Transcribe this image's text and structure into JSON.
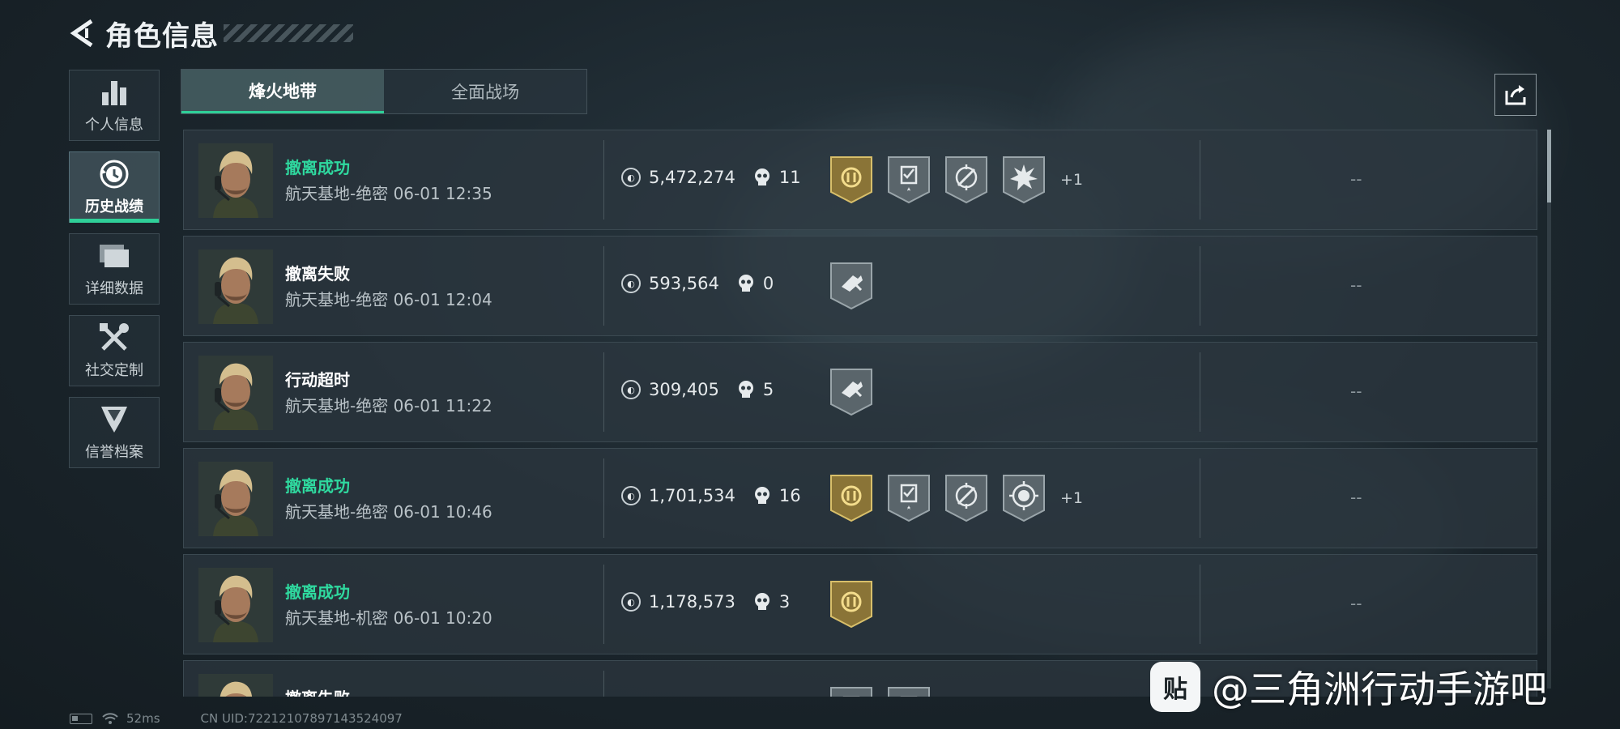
{
  "header": {
    "title": "角色信息"
  },
  "sidebar": {
    "items": [
      {
        "label": "个人信息",
        "icon": "bar-chart-icon"
      },
      {
        "label": "历史战绩",
        "icon": "history-clock-icon"
      },
      {
        "label": "详细数据",
        "icon": "folder-icon"
      },
      {
        "label": "社交定制",
        "icon": "tools-icon"
      },
      {
        "label": "信誉档案",
        "icon": "shield-emblem-icon"
      }
    ],
    "active_index": 1
  },
  "tabs": [
    {
      "label": "烽火地带"
    },
    {
      "label": "全面战场"
    }
  ],
  "records": [
    {
      "status": "撤离成功",
      "status_type": "success",
      "map": "航天基地-绝密",
      "time": "06-01 12:35",
      "value": "5,472,274",
      "kills": "11",
      "badges": [
        "gold-emblem-icon",
        "checklist-star-icon",
        "no-target-icon",
        "explosion-icon"
      ],
      "extra": "+1",
      "result": "--"
    },
    {
      "status": "撤离失败",
      "status_type": "fail",
      "map": "航天基地-绝密",
      "time": "06-01 12:04",
      "value": "593,564",
      "kills": "0",
      "badges": [
        "broken-gun-icon"
      ],
      "extra": "",
      "result": "--"
    },
    {
      "status": "行动超时",
      "status_type": "timeout",
      "map": "航天基地-绝密",
      "time": "06-01 11:22",
      "value": "309,405",
      "kills": "5",
      "badges": [
        "broken-gun-icon"
      ],
      "extra": "",
      "result": "--"
    },
    {
      "status": "撤离成功",
      "status_type": "success",
      "map": "航天基地-绝密",
      "time": "06-01 10:46",
      "value": "1,701,534",
      "kills": "16",
      "badges": [
        "gold-emblem-icon",
        "checklist-star-icon",
        "no-target-icon",
        "skull-target-icon"
      ],
      "extra": "+1",
      "result": "--"
    },
    {
      "status": "撤离成功",
      "status_type": "success",
      "map": "航天基地-机密",
      "time": "06-01 10:20",
      "value": "1,178,573",
      "kills": "3",
      "badges": [
        "gold-emblem-icon"
      ],
      "extra": "",
      "result": "--"
    },
    {
      "status": "撤离失败",
      "status_type": "fail",
      "map": "",
      "time": "",
      "value": "",
      "kills": "",
      "badges": [
        "checklist-star-icon",
        "checklist-star-icon"
      ],
      "extra": "",
      "result": ""
    }
  ],
  "footer": {
    "ping": "52ms",
    "uid": "CN UID:72212107897143524097"
  },
  "watermark": {
    "logo": "贴",
    "text": "@三角洲行动手游吧"
  },
  "colors": {
    "accent": "#2fcf98",
    "success": "#2fd99f",
    "gold": "#8a7437"
  }
}
